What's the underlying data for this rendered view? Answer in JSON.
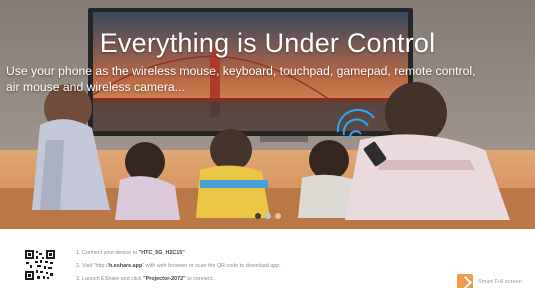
{
  "hero": {
    "title": "Everything is Under Control",
    "subtitle_line1": "Use your phone as the wireless mouse, keyboard, touchpad, gamepad, remote control,",
    "subtitle_line2": "air mouse and wireless camera..."
  },
  "carousel": {
    "dot_count": 3,
    "active_index": 0
  },
  "instructions": {
    "step1_pre": "1. Connect your device to ",
    "step1_bold": "\"HTC_5G_H2C15\"",
    "step2_pre": "2. Visit \"http://",
    "step2_bold": "h.eshare.app",
    "step2_post": "\" with web browser or scan the QR code to download app.",
    "step3_pre": "3. Launch EShare and click ",
    "step3_bold": "\"Projector-2072\"",
    "step3_post": " to connect."
  },
  "smart_toggle": {
    "label": "Smart Full screen",
    "checked": true,
    "color": "#f2994a"
  },
  "icons": {
    "qr": "qr-code-icon",
    "wifi": "wifi-signal-icon",
    "check": "checkbox-check-icon"
  }
}
